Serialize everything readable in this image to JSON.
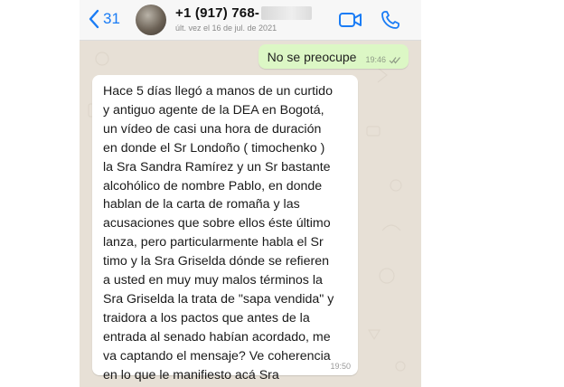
{
  "header": {
    "back_count": "31",
    "contact_number": "+1 (917) 768-",
    "last_seen": "últ. vez el 16 de jul. de 2021",
    "icons": {
      "back": "chevron-left-icon",
      "video": "video-call-icon",
      "phone": "phone-call-icon"
    },
    "accent_color": "#1a7cf5"
  },
  "chat": {
    "outgoing": {
      "text": "No se preocupe",
      "time": "19:46",
      "status_icon": "double-check-icon"
    },
    "incoming": {
      "lines": [
        "Hace 5 días llegó a manos de un curtido",
        "y antiguo agente de la DEA en Bogotá,",
        "un vídeo de casi una hora de duración",
        "en donde el Sr Londoño ( timochenko )",
        "la Sra Sandra Ramírez y un Sr bastante",
        "alcohólico de nombre Pablo, en donde",
        "hablan de la carta de romaña y las",
        "acusaciones que sobre ellos éste último",
        "lanza, pero particularmente habla el Sr",
        "timo y la Sra Griselda dónde se refieren",
        "a usted en muy muy malos términos la",
        "Sra Griselda la trata de \"sapa vendida\" y",
        "traidora a los pactos que antes de la",
        "entrada al senado habían acordado, me",
        "va captando el mensaje? Ve coherencia",
        "en lo que le manifiesto acá Sra"
      ],
      "time": "19:50"
    },
    "colors": {
      "wallpaper": "#e7e0d6",
      "outgoing_bubble": "#dcf7c5",
      "incoming_bubble": "#ffffff"
    }
  }
}
